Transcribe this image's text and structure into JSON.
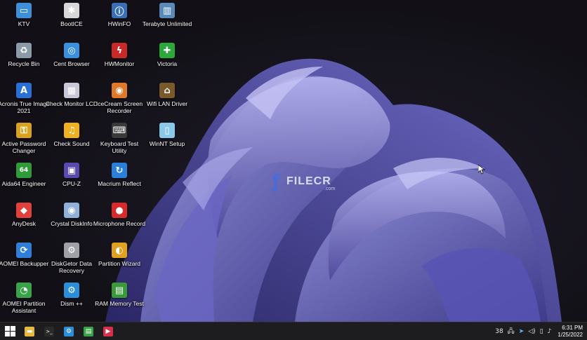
{
  "desktop": {
    "icons": [
      {
        "label": "KTV",
        "icon": "monitor-icon",
        "color": "#3c8fd8",
        "glyph": "▭"
      },
      {
        "label": "Recycle Bin",
        "icon": "recycle-bin-icon",
        "color": "#8a9aa8",
        "glyph": "♻"
      },
      {
        "label": "Acronis True Image 2021",
        "icon": "acronis-icon",
        "color": "#2a6fd6",
        "glyph": "A"
      },
      {
        "label": "Active Password Changer",
        "icon": "key-icon",
        "color": "#d9a21c",
        "glyph": "⚿"
      },
      {
        "label": "Aida64 Engineer",
        "icon": "aida64-icon",
        "color": "#2f9a3a",
        "glyph": "64"
      },
      {
        "label": "AnyDesk",
        "icon": "anydesk-icon",
        "color": "#e2403a",
        "glyph": "◆"
      },
      {
        "label": "AOMEI Backupper",
        "icon": "aomei-backupper-icon",
        "color": "#2f7fd8",
        "glyph": "⟳"
      },
      {
        "label": "AOMEI Partition Assistant",
        "icon": "aomei-partition-icon",
        "color": "#3aa34a",
        "glyph": "◔"
      },
      {
        "label": "BootICE",
        "icon": "bootice-icon",
        "color": "#d8d8d8",
        "glyph": "✱"
      },
      {
        "label": "Cent Browser",
        "icon": "cent-browser-icon",
        "color": "#3a8fe0",
        "glyph": "◎"
      },
      {
        "label": "Check Monitor LCD",
        "icon": "check-monitor-icon",
        "color": "#c8c8d8",
        "glyph": "▦"
      },
      {
        "label": "Check Sound",
        "icon": "sound-icon",
        "color": "#f0b020",
        "glyph": "♫"
      },
      {
        "label": "CPU-Z",
        "icon": "cpu-z-icon",
        "color": "#5a4ab0",
        "glyph": "▣"
      },
      {
        "label": "Crystal DiskInfo",
        "icon": "crystal-diskinfo-icon",
        "color": "#8fb0d8",
        "glyph": "◉"
      },
      {
        "label": "DiskGetor Data Recovery",
        "icon": "diskgetor-icon",
        "color": "#a0a0a8",
        "glyph": "⚙"
      },
      {
        "label": "Dism ++",
        "icon": "dism-icon",
        "color": "#2a8fd8",
        "glyph": "⚙"
      },
      {
        "label": "HWinFO",
        "icon": "hwinfo-icon",
        "color": "#3a6fb8",
        "glyph": "ⓘ"
      },
      {
        "label": "HWMonitor",
        "icon": "hwmonitor-icon",
        "color": "#c82a2a",
        "glyph": "ϟ"
      },
      {
        "label": "IceCream Screen Recorder",
        "icon": "icecream-icon",
        "color": "#e0782a",
        "glyph": "◉"
      },
      {
        "label": "Keyboard Test Utility",
        "icon": "keyboard-icon",
        "color": "#3a3a3a",
        "glyph": "⌨"
      },
      {
        "label": "Macrium Reflect",
        "icon": "macrium-icon",
        "color": "#2a7fd8",
        "glyph": "↻"
      },
      {
        "label": "Microphone Record",
        "icon": "microphone-icon",
        "color": "#d82a2a",
        "glyph": "●"
      },
      {
        "label": "Partition Wizard",
        "icon": "partition-wizard-icon",
        "color": "#e0a020",
        "glyph": "◐"
      },
      {
        "label": "RAM Memory Test",
        "icon": "ram-icon",
        "color": "#3a9a3a",
        "glyph": "▤"
      },
      {
        "label": "Terabyte Unlimited",
        "icon": "terabyte-icon",
        "color": "#5a8ab8",
        "glyph": "▥"
      },
      {
        "label": "Victoria",
        "icon": "victoria-icon",
        "color": "#2aa83a",
        "glyph": "✚"
      },
      {
        "label": "Wifi LAN Driver",
        "icon": "wifi-lan-icon",
        "color": "#7a5a2a",
        "glyph": "⌂"
      },
      {
        "label": "WinNT Setup",
        "icon": "winnt-setup-icon",
        "color": "#8ac8e8",
        "glyph": "▯"
      }
    ],
    "watermark": {
      "brand": "FILECR",
      "sub": ".com"
    }
  },
  "taskbar": {
    "pinned": [
      {
        "icon": "file-explorer-icon",
        "color": "#e8b93a",
        "glyph": "▬"
      },
      {
        "icon": "terminal-icon",
        "color": "#2a2a2a",
        "glyph": ">_"
      },
      {
        "icon": "dism-taskbar-icon",
        "color": "#2a8fd8",
        "glyph": "⚙"
      },
      {
        "icon": "task-manager-icon",
        "color": "#3aa34a",
        "glyph": "▤"
      },
      {
        "icon": "media-icon",
        "color": "#d8304a",
        "glyph": "▶"
      }
    ],
    "tray": {
      "number": "38",
      "time": "6:31 PM",
      "date": "1/25/2022"
    }
  }
}
